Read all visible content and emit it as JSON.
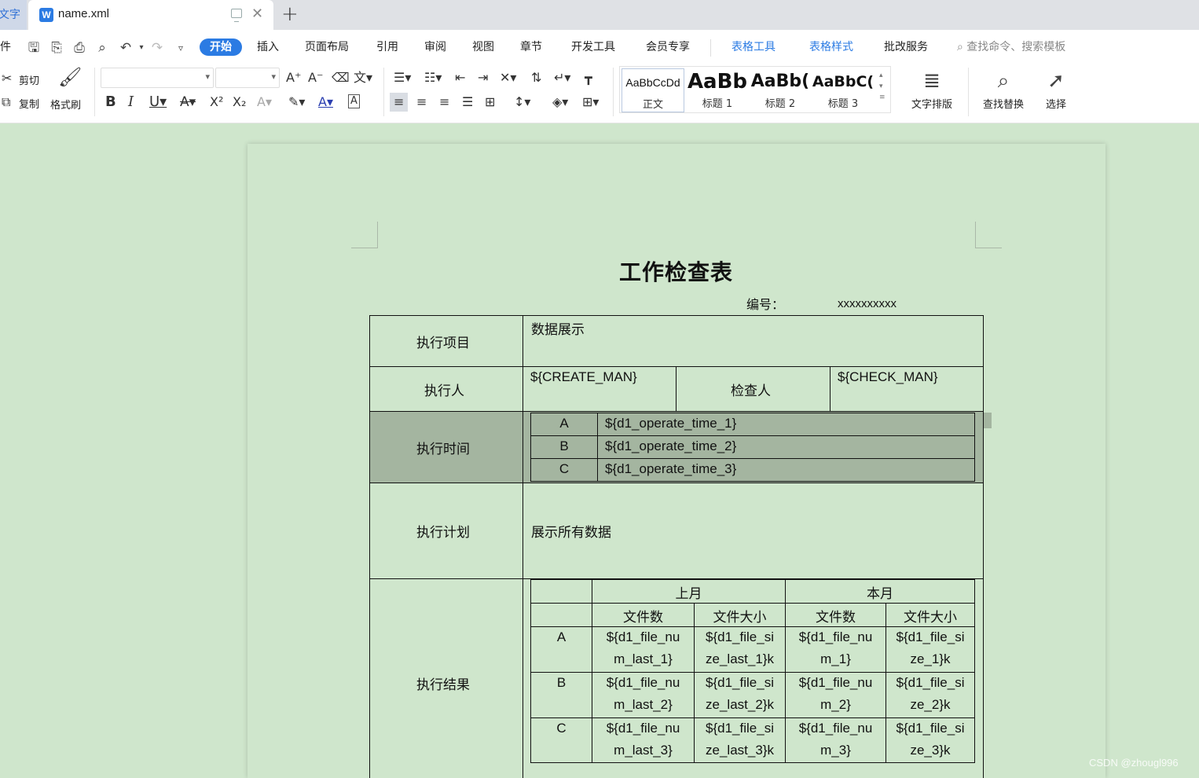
{
  "tabs": {
    "partial_label": "文字",
    "active_title": "name.xml",
    "new_tab_symbol": "+"
  },
  "menu": {
    "partial_left": "件",
    "items": [
      "开始",
      "插入",
      "页面布局",
      "引用",
      "审阅",
      "视图",
      "章节",
      "开发工具",
      "会员专享"
    ],
    "context_items": [
      "表格工具",
      "表格样式"
    ],
    "extra": "批改服务",
    "search_placeholder": "查找命令、搜索模板"
  },
  "ribbon": {
    "cut": "剪切",
    "copy": "复制",
    "format_painter": "格式刷",
    "font_name": "",
    "font_size": "",
    "styles": [
      {
        "sample": "AaBbCcDd",
        "name": "正文"
      },
      {
        "sample": "AaBb",
        "name": "标题 1"
      },
      {
        "sample": "AaBb(",
        "name": "标题 2"
      },
      {
        "sample": "AaBbC(",
        "name": "标题 3"
      }
    ],
    "text_layout": "文字排版",
    "find_replace": "查找替换",
    "select": "选择"
  },
  "document": {
    "title": "工作检查表",
    "number_label": "编号：",
    "number_value": "xxxxxxxxxx",
    "rows": {
      "project_label": "执行项目",
      "project_value": "数据展示",
      "executor_label": "执行人",
      "executor_value": "${CREATE_MAN}",
      "checker_label": "检查人",
      "checker_value": "${CHECK_MAN}",
      "time_label": "执行时间",
      "time_rows": [
        {
          "key": "A",
          "value": "${d1_operate_time_1}"
        },
        {
          "key": "B",
          "value": "${d1_operate_time_2}"
        },
        {
          "key": "C",
          "value": "${d1_operate_time_3}"
        }
      ],
      "plan_label": "执行计划",
      "plan_value": "展示所有数据",
      "result_label": "执行结果",
      "result_table": {
        "group_last": "上月",
        "group_this": "本月",
        "col_count": "文件数",
        "col_size": "文件大小",
        "rows": [
          {
            "key": "A",
            "last_num": [
              "${d1_file_nu",
              "m_last_1}"
            ],
            "last_size": [
              "${d1_file_si",
              "ze_last_1}k"
            ],
            "this_num": [
              "${d1_file_nu",
              "m_1}"
            ],
            "this_size": [
              "${d1_file_si",
              "ze_1}k"
            ]
          },
          {
            "key": "B",
            "last_num": [
              "${d1_file_nu",
              "m_last_2}"
            ],
            "last_size": [
              "${d1_file_si",
              "ze_last_2}k"
            ],
            "this_num": [
              "${d1_file_nu",
              "m_2}"
            ],
            "this_size": [
              "${d1_file_si",
              "ze_2}k"
            ]
          },
          {
            "key": "C",
            "last_num": [
              "${d1_file_nu",
              "m_last_3}"
            ],
            "last_size": [
              "${d1_file_si",
              "ze_last_3}k"
            ],
            "this_num": [
              "${d1_file_nu",
              "m_3}"
            ],
            "this_size": [
              "${d1_file_si",
              "ze_3}k"
            ]
          }
        ]
      }
    }
  },
  "watermark": "CSDN @zhougl996",
  "colors": {
    "accent": "#2b7be3",
    "page_background": "#cfe6cc",
    "selection_fill": "#a4b5a0"
  }
}
